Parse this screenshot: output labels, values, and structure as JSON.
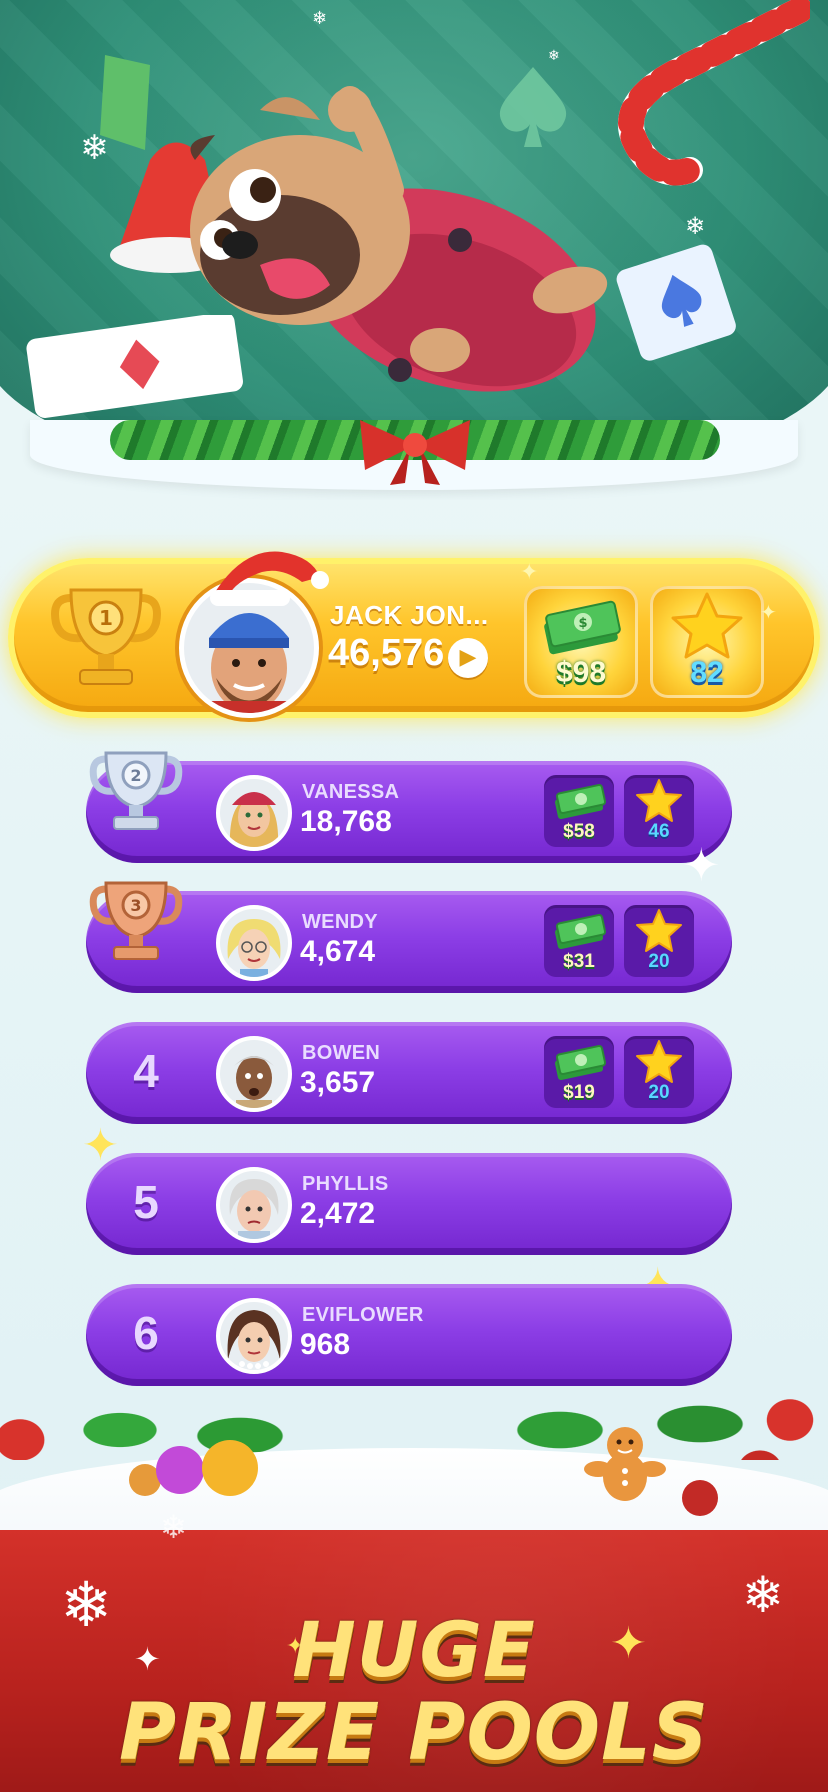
{
  "leaderboard": {
    "first": {
      "rank": 1,
      "name": "JACK JON...",
      "score": "46,576",
      "cash_prize": "$98",
      "star_prize": "82"
    },
    "rows": [
      {
        "rank": "2",
        "name": "VANESSA",
        "score": "18,768",
        "cash": "$58",
        "stars": "46"
      },
      {
        "rank": "3",
        "name": "WENDY",
        "score": "4,674",
        "cash": "$31",
        "stars": "20"
      },
      {
        "rank": "4",
        "name": "BOWEN",
        "score": "3,657",
        "cash": "$19",
        "stars": "20"
      },
      {
        "rank": "5",
        "name": "PHYLLIS",
        "score": "2,472"
      },
      {
        "rank": "6",
        "name": "EVIFLOWER",
        "score": "968"
      }
    ]
  },
  "tagline": {
    "line1": "HUGE",
    "line2": "PRIZE POOLS"
  },
  "icons": {
    "trophy_1": "gold-trophy-icon",
    "trophy_2": "silver-trophy-icon",
    "trophy_3": "bronze-trophy-icon",
    "cash": "cash-stack-icon",
    "star": "star-icon",
    "play": "play-icon"
  },
  "colors": {
    "gold": "#ffc52b",
    "purple": "#8c3ee6",
    "hero_green": "#2e8f77",
    "footer_red": "#c62a24"
  }
}
